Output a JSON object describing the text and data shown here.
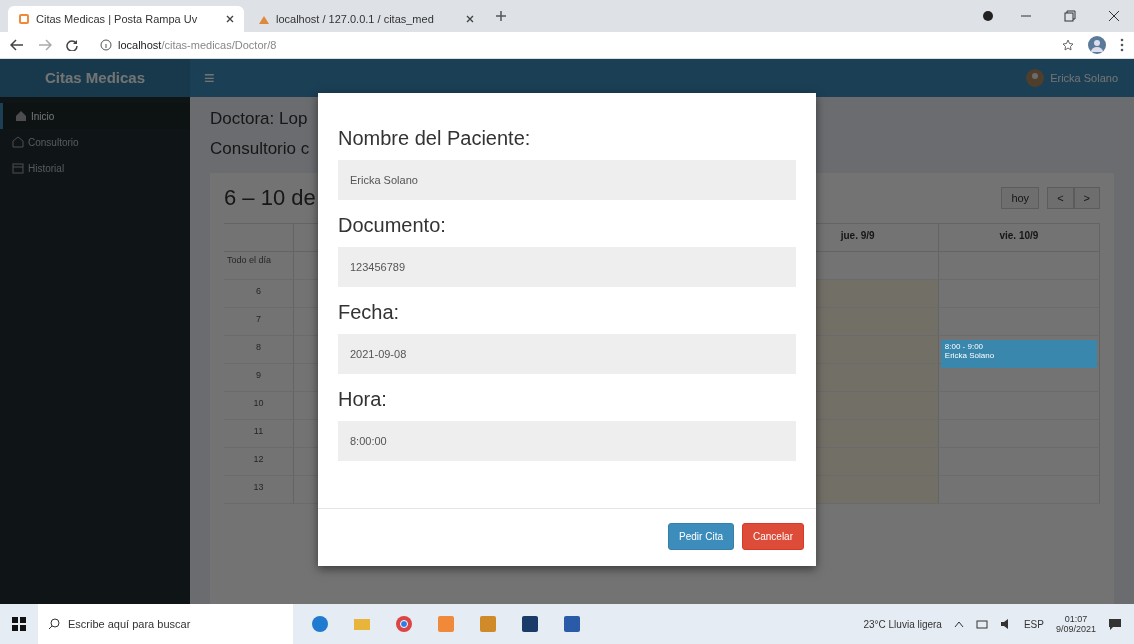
{
  "browser": {
    "tabs": [
      {
        "title": "Citas Medicas | Posta Rampa Uv",
        "selected": true
      },
      {
        "title": "localhost / 127.0.0.1 / citas_med",
        "selected": false
      }
    ],
    "url_host": "localhost",
    "url_path": "/citas-medicas/Doctor/8"
  },
  "app": {
    "brand": "Citas Medicas",
    "menu_icon": "≡",
    "user": "Ericka Solano"
  },
  "sidebar": {
    "items": [
      {
        "label": "Inicio",
        "selected": true
      },
      {
        "label": "Consultorio",
        "selected": false
      },
      {
        "label": "Historial",
        "selected": false
      }
    ]
  },
  "content": {
    "doctor": "Doctora: Lop",
    "office": "Consultorio c"
  },
  "calendar": {
    "title": "6 – 10 de",
    "buttons": [
      "hoy",
      "<",
      ">"
    ],
    "allday": "Todo el día",
    "hours": [
      "6",
      "7",
      "8",
      "9",
      "10",
      "11",
      "12",
      "13"
    ],
    "days": [
      {
        "label": "jue. 9/9",
        "today": true
      },
      {
        "label": "vie. 10/9",
        "today": false,
        "event": {
          "time": "8:00 - 9:00",
          "title": "Ericka Solano"
        }
      }
    ]
  },
  "modal": {
    "fields": [
      {
        "label": "Nombre del Paciente:",
        "value": "Ericka Solano"
      },
      {
        "label": "Documento:",
        "value": "123456789"
      },
      {
        "label": "Fecha:",
        "value": "2021-09-08"
      },
      {
        "label": "Hora:",
        "value": "8:00:00"
      }
    ],
    "buttons": [
      {
        "label": "Pedir Cita",
        "kind": "primary"
      },
      {
        "label": "Cancelar",
        "kind": "danger"
      }
    ]
  },
  "taskbar": {
    "search": "Escribe aquí para buscar",
    "weather": "23°C  Lluvia ligera",
    "lang": "ESP",
    "time": "01:07",
    "date": "9/09/2021"
  }
}
